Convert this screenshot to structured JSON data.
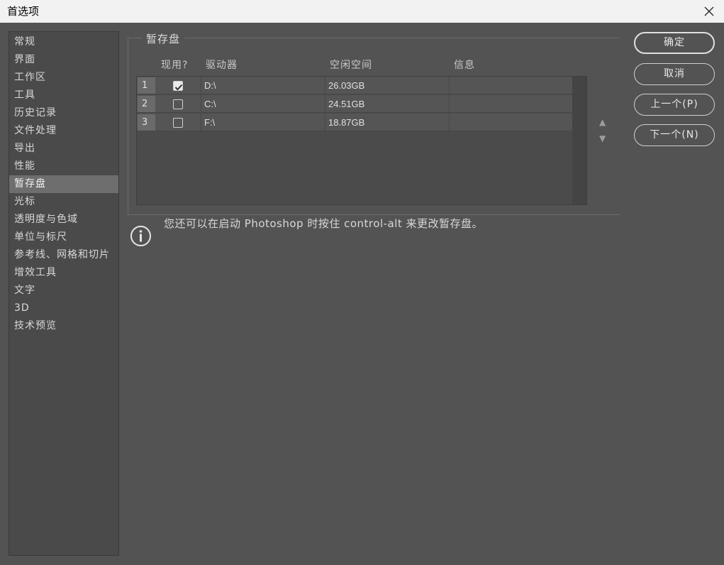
{
  "window": {
    "title": "首选项"
  },
  "sidebar": {
    "items": [
      {
        "label": "常规",
        "active": false
      },
      {
        "label": "界面",
        "active": false
      },
      {
        "label": "工作区",
        "active": false
      },
      {
        "label": "工具",
        "active": false
      },
      {
        "label": "历史记录",
        "active": false
      },
      {
        "label": "文件处理",
        "active": false
      },
      {
        "label": "导出",
        "active": false
      },
      {
        "label": "性能",
        "active": false
      },
      {
        "label": "暂存盘",
        "active": true
      },
      {
        "label": "光标",
        "active": false
      },
      {
        "label": "透明度与色域",
        "active": false
      },
      {
        "label": "单位与标尺",
        "active": false
      },
      {
        "label": "参考线、网格和切片",
        "active": false
      },
      {
        "label": "增效工具",
        "active": false
      },
      {
        "label": "文字",
        "active": false
      },
      {
        "label": "3D",
        "active": false
      },
      {
        "label": "技术预览",
        "active": false
      }
    ]
  },
  "scratch": {
    "group_title": "暂存盘",
    "headers": {
      "active": "现用?",
      "drive": "驱动器",
      "free_space": "空闲空间",
      "info": "信息"
    },
    "rows": [
      {
        "num": "1",
        "checked": true,
        "drive": "D:\\",
        "free": "26.03GB",
        "info": ""
      },
      {
        "num": "2",
        "checked": false,
        "drive": "C:\\",
        "free": "24.51GB",
        "info": ""
      },
      {
        "num": "3",
        "checked": false,
        "drive": "F:\\",
        "free": "18.87GB",
        "info": ""
      }
    ],
    "move_up": "▲",
    "move_down": "▼"
  },
  "info": {
    "icon": "info-circle-icon",
    "text": "您还可以在启动 Photoshop 时按住 control-alt 来更改暂存盘。"
  },
  "buttons": {
    "ok": "确定",
    "cancel": "取消",
    "prev": "上一个(P)",
    "next": "下一个(N)"
  },
  "colors": {
    "background": "#535353",
    "titlebar": "#f2f2f2",
    "sidebar_active": "#6e6e6e"
  }
}
